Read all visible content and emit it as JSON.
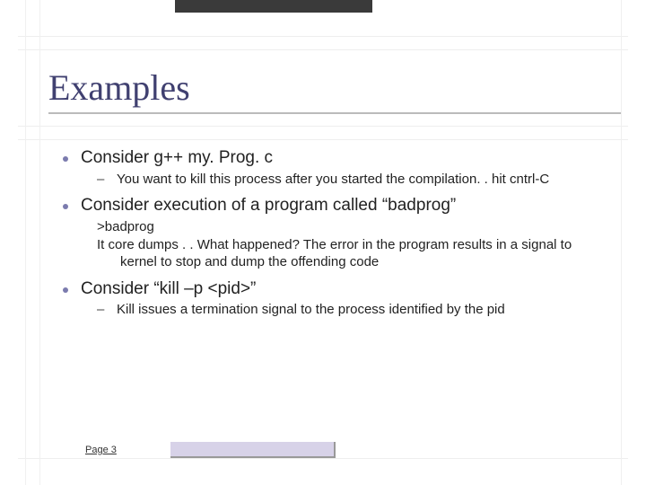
{
  "title": "Examples",
  "bullets": [
    {
      "text": "Consider g++ my. Prog. c",
      "subs": [
        {
          "type": "dash",
          "text": "You want to kill this process after you started the compilation. . hit cntrl-C"
        }
      ]
    },
    {
      "text": "Consider execution of a program called “badprog”",
      "subs": [
        {
          "type": "plain",
          "text": ">badprog"
        },
        {
          "type": "plain-indent",
          "text": "It core dumps . . What happened? The error in the program results in a signal to kernel to stop and dump the offending code"
        }
      ]
    },
    {
      "text": "Consider “kill –p <pid>”",
      "subs": [
        {
          "type": "dash",
          "text": "Kill issues a termination signal to the process identified by the pid"
        }
      ]
    }
  ],
  "footer": {
    "page_label": "Page 3"
  }
}
